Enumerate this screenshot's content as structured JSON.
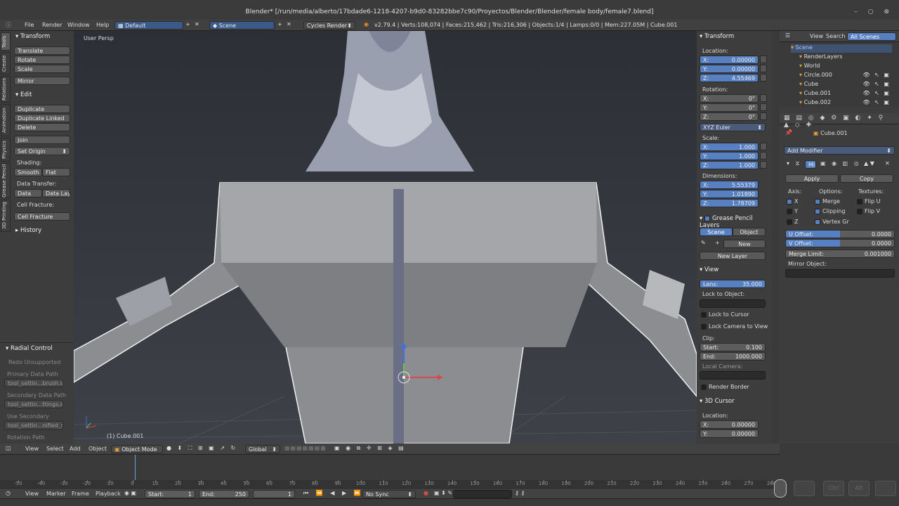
{
  "title": "Blender* [/run/media/alberto/17bdade6-1218-4207-b9d0-83282bbe7c90/Proyectos/Blender/Blender/female body/female7.blend]",
  "menu": {
    "file": "File",
    "render": "Render",
    "window": "Window",
    "help": "Help",
    "layout": "Default",
    "scene": "Scene",
    "engine": "Cycles Render",
    "stats": "v2.79.4 | Verts:108,074 | Faces:215,462 | Tris:216,306 | Objects:1/4 | Lamps:0/0 | Mem:227.05M | Cube.001"
  },
  "tool_tabs": [
    "Tools",
    "Create",
    "Relations",
    "Animation",
    "Physics",
    "Grease Pencil",
    "3D Printing"
  ],
  "tools": {
    "transform_head": "Transform",
    "translate": "Translate",
    "rotate": "Rotate",
    "scale": "Scale",
    "mirror": "Mirror",
    "edit_head": "Edit",
    "duplicate": "Duplicate",
    "duplicate_linked": "Duplicate Linked",
    "delete": "Delete",
    "join": "Join",
    "set_origin": "Set Origin",
    "shading": "Shading:",
    "smooth": "Smooth",
    "flat": "Flat",
    "data_transfer": "Data Transfer:",
    "data": "Data",
    "data_layo": "Data Layo",
    "cell_fracture_label": "Cell Fracture:",
    "cell_fracture": "Cell Fracture",
    "history": "History"
  },
  "radial": {
    "head": "Radial Control",
    "redo": "Redo Unsupported",
    "primary": "Primary Data Path",
    "primary_val": "tool_settin...brush.size",
    "secondary": "Secondary Data Path",
    "secondary_val": "tool_settin...ttings.size",
    "use_secondary": "Use Secondary",
    "use_secondary_val": "tool_settin...nified_size",
    "rotation": "Rotation Path"
  },
  "viewport": {
    "persp": "User Persp",
    "object": "(1) Cube.001"
  },
  "npanel": {
    "transform": "Transform",
    "location": "Location:",
    "loc": [
      [
        "X:",
        "0.00000"
      ],
      [
        "Y:",
        "0.00000"
      ],
      [
        "Z:",
        "4.55469"
      ]
    ],
    "rotation": "Rotation:",
    "rot": [
      [
        "X:",
        "0°"
      ],
      [
        "Y:",
        "0°"
      ],
      [
        "Z:",
        "0°"
      ]
    ],
    "euler": "XYZ Euler",
    "scale": "Scale:",
    "scl": [
      [
        "X:",
        "1.000"
      ],
      [
        "Y:",
        "1.000"
      ],
      [
        "Z:",
        "1.000"
      ]
    ],
    "dimensions": "Dimensions:",
    "dim": [
      [
        "X:",
        "5.55379"
      ],
      [
        "Y:",
        "1.01890"
      ],
      [
        "Z:",
        "1.78709"
      ]
    ],
    "gp_head": "Grease Pencil Layers",
    "gp_scene": "Scene",
    "gp_object": "Object",
    "gp_new": "New",
    "gp_new_layer": "New Layer",
    "view_head": "View",
    "lens": "Lens:",
    "lens_val": "35.000",
    "lock_obj": "Lock to Object:",
    "lock_cursor": "Lock to Cursor",
    "lock_camera": "Lock Camera to View",
    "clip": "Clip:",
    "start": "Start:",
    "start_val": "0.100",
    "end": "End:",
    "end_val": "1000.000",
    "local_camera": "Local Camera:",
    "render_border": "Render Border",
    "cursor_head": "3D Cursor",
    "cur_location": "Location:",
    "cur": [
      [
        "X:",
        "0.00000"
      ],
      [
        "Y:",
        "0.00000"
      ]
    ]
  },
  "outliner": {
    "view": "View",
    "search": "Search",
    "all_scenes": "All Scenes",
    "items": [
      "Scene",
      "RenderLayers",
      "World",
      "Circle.000",
      "Cube",
      "Cube.001",
      "Cube.002"
    ]
  },
  "props": {
    "object": "Cube.001",
    "add_modifier": "Add Modifier",
    "mod_name": "Mir",
    "apply": "Apply",
    "copy": "Copy",
    "axis": "Axis:",
    "options": "Options:",
    "textures": "Textures:",
    "x": "X",
    "y": "Y",
    "z": "Z",
    "merge": "Merge",
    "clipping": "Clipping",
    "vertex_gr": "Vertex Gr",
    "flip_u": "Flip U",
    "flip_v": "Flip V",
    "u_offset": "U Offset:",
    "u_val": "0.0000",
    "v_offset": "V Offset:",
    "v_val": "0.0000",
    "merge_limit": "Merge Limit:",
    "merge_val": "0.001000",
    "mirror_object": "Mirror Object:"
  },
  "vheader": {
    "view": "View",
    "select": "Select",
    "add": "Add",
    "object": "Object",
    "mode": "Object Mode",
    "global": "Global"
  },
  "timeline": {
    "ticks": [
      "-50",
      "-40",
      "-30",
      "-20",
      "-10",
      "0",
      "10",
      "20",
      "30",
      "40",
      "50",
      "60",
      "70",
      "80",
      "90",
      "100",
      "110",
      "120",
      "130",
      "140",
      "150",
      "160",
      "170",
      "180",
      "190",
      "200",
      "210",
      "220",
      "230",
      "240",
      "250",
      "260",
      "270",
      "280"
    ],
    "view": "View",
    "marker": "Marker",
    "frame": "Frame",
    "playback": "Playback",
    "start": "Start:",
    "start_val": "1",
    "end": "End:",
    "end_val": "250",
    "current": "1",
    "sync": "No Sync"
  },
  "keys": {
    "ctrl": "Ctrl",
    "alt": "Alt"
  }
}
